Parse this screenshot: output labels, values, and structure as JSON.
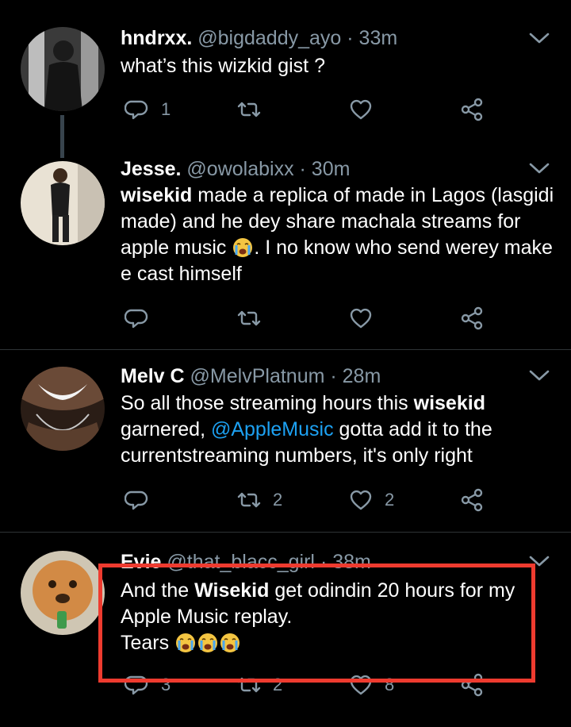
{
  "colors": {
    "background": "#000000",
    "text": "#ffffff",
    "secondary": "#8899a6",
    "mention": "#1da1f2",
    "highlight_border": "#ee3b2f"
  },
  "tweets": [
    {
      "name": "hndrxx.",
      "handle": "@bigdaddy_ayo",
      "time": "· 33m",
      "text": "what’s this wizkid gist ?",
      "reply_count": "1",
      "retweet_count": "",
      "like_count": ""
    },
    {
      "name": "Jesse.",
      "handle": "@owolabixx",
      "time": "· 30m",
      "text_bold": "wisekid",
      "text_1": " made a replica of made in Lagos (lasgidi made) and he dey share machala streams for apple music ",
      "text_2": ". I no know who send werey make e cast himself",
      "reply_count": "",
      "retweet_count": "",
      "like_count": ""
    },
    {
      "name": "Melv C",
      "handle": "@MelvPlatnum",
      "time": "· 28m",
      "text_1": "So all those streaming hours this ",
      "text_bold": "wisekid",
      "text_2": " garnered, ",
      "mention": "@AppleMusic",
      "text_3": " gotta add it to the currentstreaming numbers, it's only right",
      "reply_count": "",
      "retweet_count": "2",
      "like_count": "2"
    },
    {
      "name": "Evie",
      "handle": "@that_blacc_girl",
      "time": "· 38m",
      "text_1": "And the ",
      "text_bold": "Wisekid",
      "text_2": " get odindin 20 hours for my Apple Music replay.",
      "text_3": "Tears ",
      "reply_count": "3",
      "retweet_count": "2",
      "like_count": "8"
    }
  ],
  "icons": {
    "reply": "reply-icon",
    "retweet": "retweet-icon",
    "like": "heart-icon",
    "share": "share-icon",
    "caret": "chevron-down-icon",
    "crying": "loudly-crying-face-icon"
  }
}
